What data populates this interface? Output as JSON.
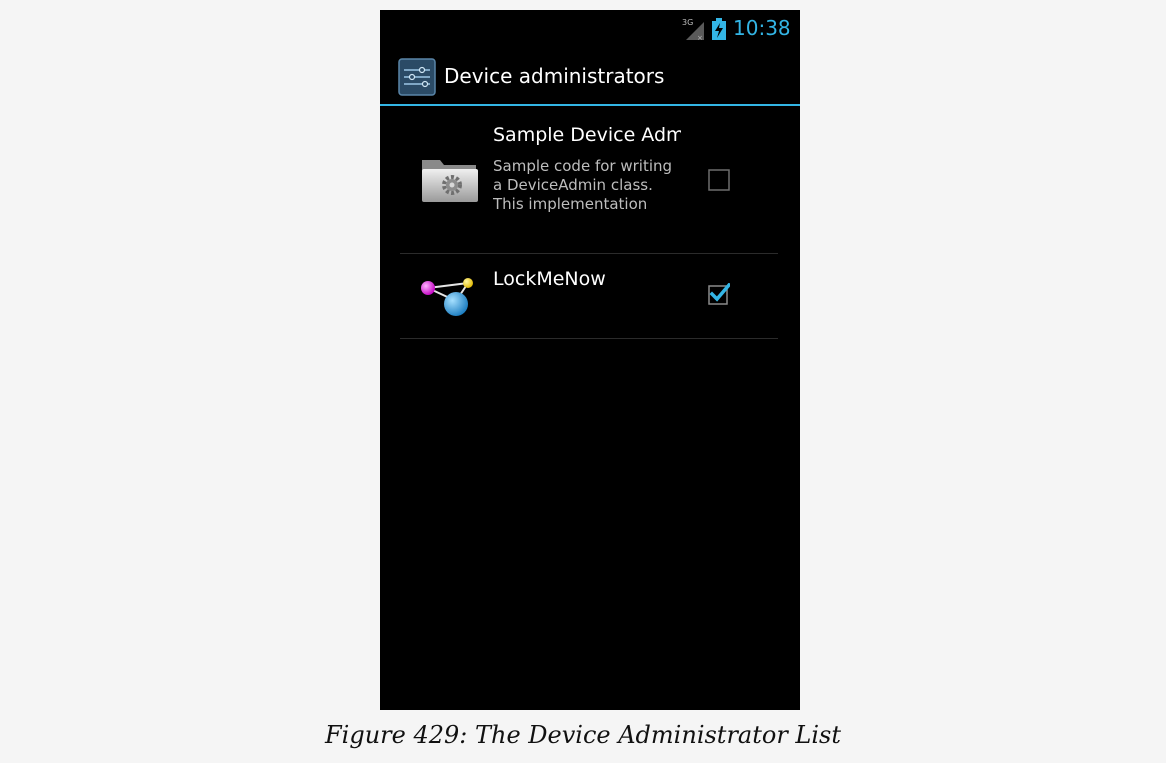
{
  "status_bar": {
    "network_label": "3G",
    "time": "10:38",
    "accent_color": "#33b5e5",
    "icons": [
      "network-3g-icon",
      "battery-charging-icon"
    ]
  },
  "action_bar": {
    "title": "Device administrators",
    "icon": "settings-sliders-icon"
  },
  "admins": [
    {
      "title": "Sample Device Admin",
      "description": "Sample code for writing a DeviceAdmin class. This implementation",
      "icon": "folder-gear-icon",
      "checked": false
    },
    {
      "title": "LockMeNow",
      "description": "",
      "icon": "molecule-icon",
      "checked": true
    }
  ],
  "caption": "Figure 429: The Device Administrator List"
}
